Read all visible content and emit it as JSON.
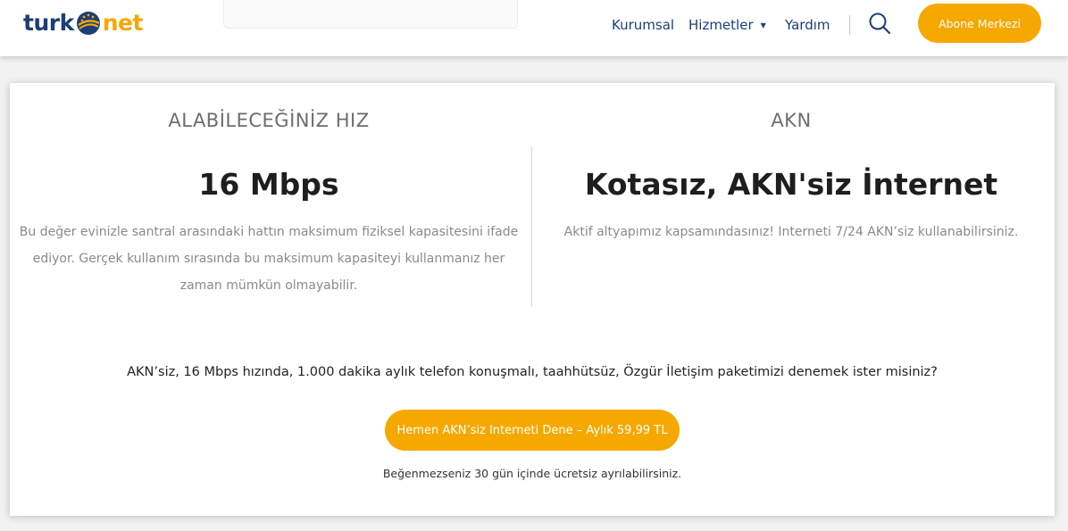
{
  "brand": {
    "logo_left": "turk",
    "logo_right": "net",
    "accent_color": "#f5a800",
    "navy_color": "#1b3e78"
  },
  "nav": {
    "items": [
      {
        "label": "Kurumsal"
      },
      {
        "label": "Hizmetler",
        "has_dropdown": true
      },
      {
        "label": "Yardım"
      }
    ],
    "search_icon": "search-icon",
    "account_button": "Abone Merkezi"
  },
  "speed": {
    "title": "ALABİLECEĞİNİZ HIZ",
    "value": "16 Mbps",
    "description_lines": [
      "Bu değer evinizle santral arasındaki hattın maksimum fiziksel kapasitesini ifade",
      "ediyor. Gerçek kullanım sırasında bu maksimum kapasiteyi kullanmanız her",
      "zaman mümkün olmayabilir."
    ]
  },
  "akn": {
    "title": "AKN",
    "value": "Kotasız, AKN'siz İnternet",
    "description": "Aktif altyapımız kapsamındasınız! Interneti 7/24 AKN’siz kullanabilirsiniz."
  },
  "offer": {
    "text": "AKN’siz, 16 Mbps hızında, 1.000 dakika aylık telefon konuşmalı, taahhütsüz, Özgür İletişim paketimizi denemek ister misiniz?",
    "cta": "Hemen AKN’siz Interneti Dene – Aylık 59,99 TL",
    "note": "Beğenmezseniz 30 gün içinde ücretsiz ayrılabilirsiniz."
  }
}
